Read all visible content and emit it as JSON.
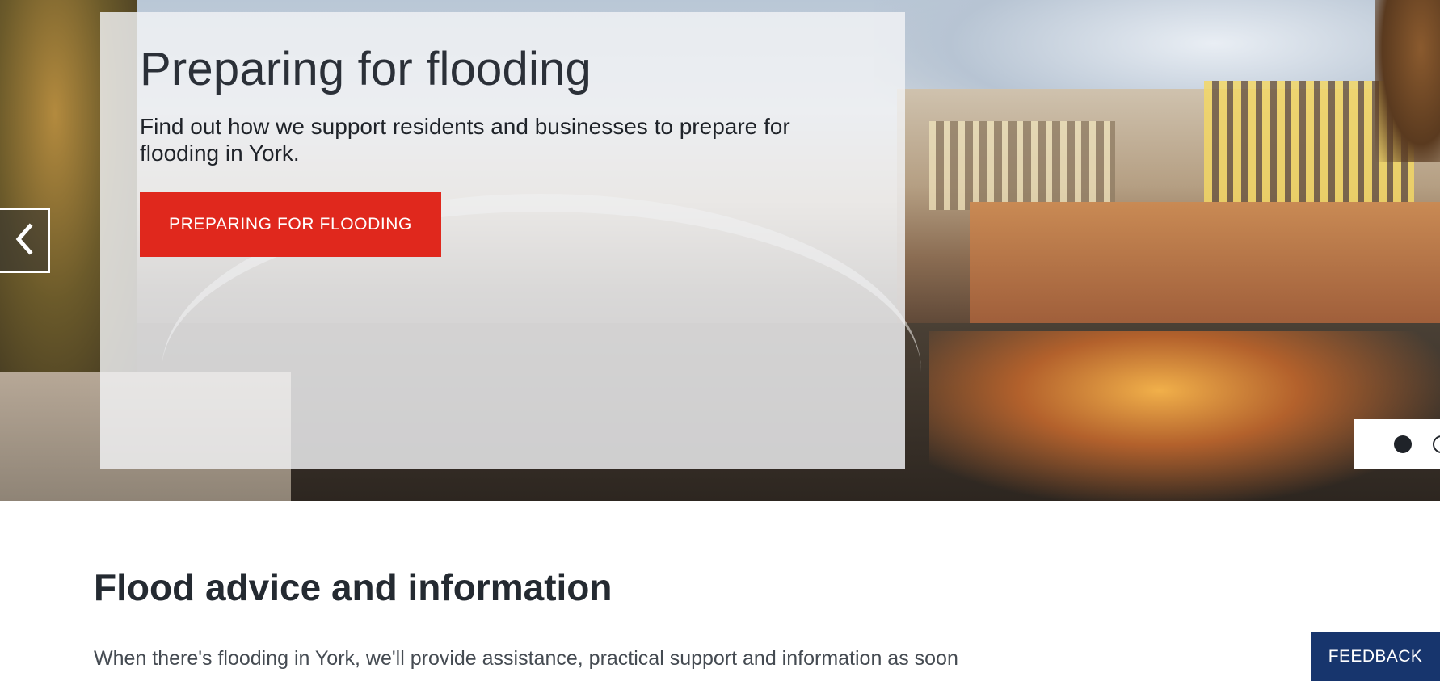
{
  "hero": {
    "title": "Preparing for flooding",
    "description": "Find out how we support residents and businesses to prepare for flooding in York.",
    "cta_label": "PREPARING FOR FLOODING"
  },
  "carousel": {
    "prev_icon": "chevron-left-icon",
    "slide_count_visible": 2,
    "active_index": 0
  },
  "main": {
    "heading": "Flood advice and information",
    "intro": "When there's flooding in York, we'll provide assistance, practical support and information as soon"
  },
  "feedback": {
    "label": "FEEDBACK"
  },
  "colors": {
    "cta": "#e0281d",
    "feedback": "#17356d",
    "heading_text": "#242a31"
  }
}
